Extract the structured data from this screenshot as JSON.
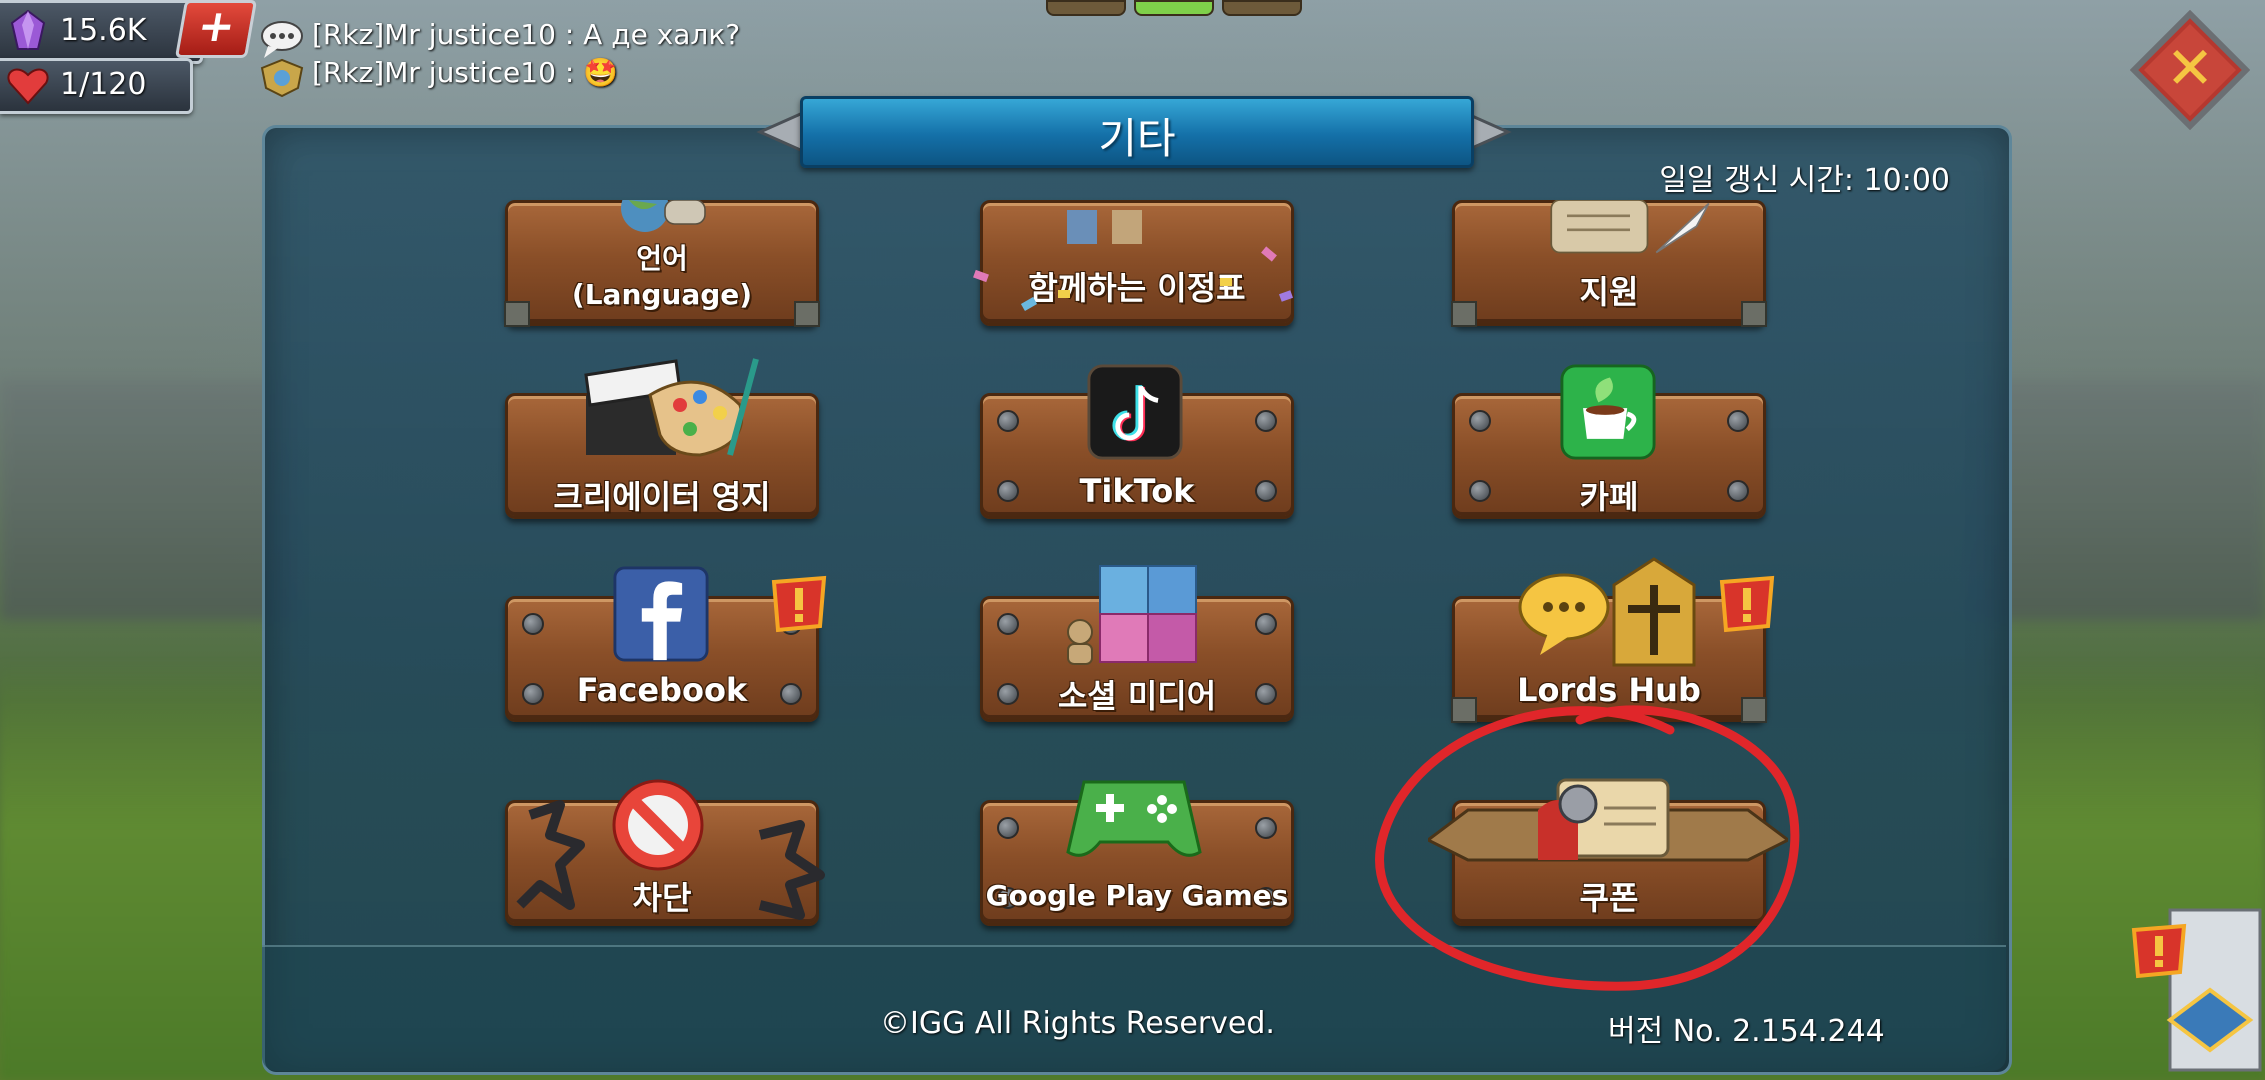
{
  "resources": {
    "gems": "15.6K",
    "stamina": "1/120",
    "add_label": "+"
  },
  "chat": {
    "lines": [
      {
        "sender": "[Rkz]Mr justice10",
        "separator": ":",
        "message": "А де халк?"
      },
      {
        "sender": "[Rkz]Mr justice10",
        "separator": ":",
        "message": "🤩"
      }
    ]
  },
  "header": {
    "title": "기타",
    "refresh_time": "일일 갱신 시간: 10:00",
    "close_label": "✕"
  },
  "menu": {
    "items": [
      {
        "label_line1": "언어",
        "label_line2": "(Language)",
        "icon": "globe-speech-icon"
      },
      {
        "label": "함께하는 이정표",
        "icon": "milestone-icon"
      },
      {
        "label": "지원",
        "icon": "scroll-quill-icon"
      },
      {
        "label": "크리에이터 영지",
        "icon": "clapper-palette-icon"
      },
      {
        "label": "TikTok",
        "icon": "tiktok-icon"
      },
      {
        "label": "카페",
        "icon": "cafe-cup-icon"
      },
      {
        "label": "Facebook",
        "icon": "facebook-icon",
        "alert": true
      },
      {
        "label": "소셜 미디어",
        "icon": "social-puzzle-icon"
      },
      {
        "label": "Lords Hub",
        "icon": "lords-hub-icon",
        "alert": true
      },
      {
        "label": "차단",
        "icon": "block-icon"
      },
      {
        "label": "Google Play Games",
        "icon": "google-play-games-icon"
      },
      {
        "label": "쿠폰",
        "icon": "coupon-icon"
      }
    ]
  },
  "footer": {
    "copyright": "©IGG All Rights Reserved.",
    "version": "버전 No. 2.154.244"
  },
  "colors": {
    "title_banner": "#1a84bf",
    "button_wood": "#8a4f28",
    "close_red": "#b5382f",
    "highlight_circle": "#e0262a"
  }
}
